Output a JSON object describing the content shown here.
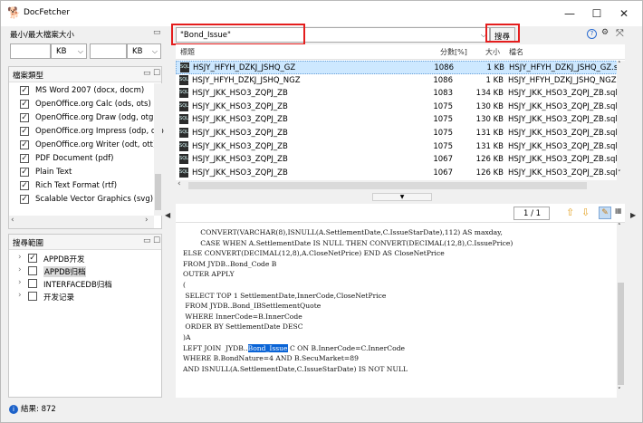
{
  "window": {
    "title": "DocFetcher",
    "minimize_label": "—",
    "maximize_label": "☐",
    "close_label": "✕"
  },
  "size_filter": {
    "header": "最小/最大檔案大小",
    "min_value": "",
    "min_unit": "KB",
    "max_value": "",
    "max_unit": "KB"
  },
  "file_types": {
    "header": "檔案類型",
    "items": [
      {
        "label": "MS Word 2007 (docx, docm)",
        "checked": true
      },
      {
        "label": "OpenOffice.org Calc (ods, ots)",
        "checked": true
      },
      {
        "label": "OpenOffice.org Draw (odg, otg)",
        "checked": true
      },
      {
        "label": "OpenOffice.org Impress (odp, otp",
        "checked": true
      },
      {
        "label": "OpenOffice.org Writer (odt, ott)",
        "checked": true
      },
      {
        "label": "PDF Document (pdf)",
        "checked": true
      },
      {
        "label": "Plain Text",
        "checked": true
      },
      {
        "label": "Rich Text Format (rtf)",
        "checked": true
      },
      {
        "label": "Scalable Vector Graphics (svg)",
        "checked": true
      }
    ]
  },
  "search_scope": {
    "header": "搜尋範圍",
    "items": [
      {
        "label": "APPDB开发",
        "checked": true
      },
      {
        "label": "APPDB归档",
        "checked": false
      },
      {
        "label": "INTERFACEDB归档",
        "checked": false
      },
      {
        "label": "开发记录",
        "checked": false
      }
    ]
  },
  "search": {
    "query": "\"Bond_Issue\"",
    "button_label": "搜尋"
  },
  "results": {
    "columns": {
      "title": "標題",
      "score": "分數[%]",
      "size": "大小",
      "filename": "檔名"
    },
    "rows": [
      {
        "title": "HSJY_HFYH_DZKJ_JSHQ_GZ",
        "score": "1086",
        "size": "1 KB",
        "filename": "HSJY_HFYH_DZKJ_JSHQ_GZ.sql"
      },
      {
        "title": "HSJY_HFYH_DZKJ_JSHQ_NGZ",
        "score": "1086",
        "size": "1 KB",
        "filename": "HSJY_HFYH_DZKJ_JSHQ_NGZ.s"
      },
      {
        "title": "HSJY_JKK_HSO3_ZQPJ_ZB",
        "score": "1083",
        "size": "134 KB",
        "filename": "HSJY_JKK_HSO3_ZQPJ_ZB.sql"
      },
      {
        "title": "HSJY_JKK_HSO3_ZQPJ_ZB",
        "score": "1075",
        "size": "130 KB",
        "filename": "HSJY_JKK_HSO3_ZQPJ_ZB.sql"
      },
      {
        "title": "HSJY_JKK_HSO3_ZQPJ_ZB",
        "score": "1075",
        "size": "130 KB",
        "filename": "HSJY_JKK_HSO3_ZQPJ_ZB.sql"
      },
      {
        "title": "HSJY_JKK_HSO3_ZQPJ_ZB",
        "score": "1075",
        "size": "131 KB",
        "filename": "HSJY_JKK_HSO3_ZQPJ_ZB.sql"
      },
      {
        "title": "HSJY_JKK_HSO3_ZQPJ_ZB",
        "score": "1075",
        "size": "131 KB",
        "filename": "HSJY_JKK_HSO3_ZQPJ_ZB.sql"
      },
      {
        "title": "HSJY_JKK_HSO3_ZQPJ_ZB",
        "score": "1067",
        "size": "126 KB",
        "filename": "HSJY_JKK_HSO3_ZQPJ_ZB.sql"
      },
      {
        "title": "HSJY_JKK_HSO3_ZQPJ_ZB",
        "score": "1067",
        "size": "126 KB",
        "filename": "HSJY_JKK_HSO3_ZQPJ_ZB.sql"
      }
    ]
  },
  "preview": {
    "page_indicator": "1 / 1",
    "code_lines": [
      {
        "pre": "        CONVERT(VARCHAR(8),ISNULL(A.SettlementDate,C.IssueStarDate),112) AS maxday,",
        "hl": "",
        "post": ""
      },
      {
        "pre": "        CASE WHEN A.SettlementDate IS NULL THEN CONVERT(DECIMAL(12,8),C.IssuePrice)",
        "hl": "",
        "post": ""
      },
      {
        "pre": "ELSE CONVERT(DECIMAL(12,8),A.CloseNetPrice) END AS CloseNetPrice",
        "hl": "",
        "post": ""
      },
      {
        "pre": "FROM JYDB..Bond_Code B",
        "hl": "",
        "post": ""
      },
      {
        "pre": "OUTER APPLY",
        "hl": "",
        "post": ""
      },
      {
        "pre": "(",
        "hl": "",
        "post": ""
      },
      {
        "pre": " SELECT TOP 1 SettlementDate,InnerCode,CloseNetPrice",
        "hl": "",
        "post": ""
      },
      {
        "pre": " FROM JYDB..Bond_IBSettlementQuote",
        "hl": "",
        "post": ""
      },
      {
        "pre": " WHERE InnerCode=B.InnerCode",
        "hl": "",
        "post": ""
      },
      {
        "pre": " ORDER BY SettlementDate DESC",
        "hl": "",
        "post": ""
      },
      {
        "pre": ")A",
        "hl": "",
        "post": ""
      },
      {
        "pre": "LEFT JOIN  JYDB..",
        "hl": "Bond_Issue",
        "post": " C ON B.InnerCode=C.InnerCode"
      },
      {
        "pre": "WHERE B.BondNature=4 AND B.SecuMarket=89",
        "hl": "",
        "post": ""
      },
      {
        "pre": "AND ISNULL(A.SettlementDate,C.IssueStarDate) IS NOT NULL",
        "hl": "",
        "post": ""
      }
    ]
  },
  "status": {
    "text": "結果: 872"
  },
  "colors": {
    "highlight": "#0a64d6",
    "annotation_red": "#e41d1d",
    "selected_row": "#cde8ff"
  }
}
